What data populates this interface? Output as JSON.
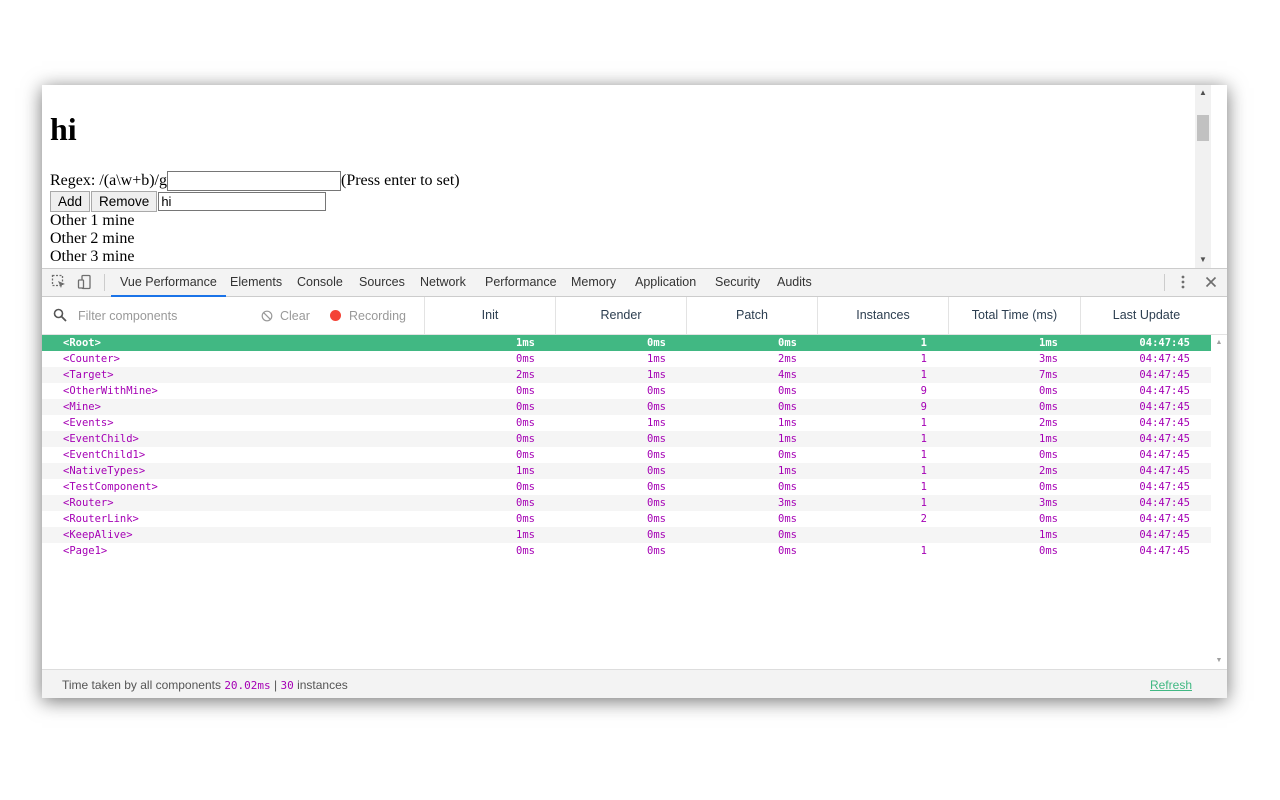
{
  "page": {
    "heading": "hi",
    "regex_label": "Regex: /(a\\w+b)/g",
    "regex_input_value": "",
    "regex_hint": "(Press enter to set)",
    "add_button": "Add",
    "remove_button": "Remove",
    "item_input_value": "hi",
    "others": [
      "Other 1 mine",
      "Other 2 mine",
      "Other 3 mine"
    ]
  },
  "devtools": {
    "tabs": [
      "Vue Performance",
      "Elements",
      "Console",
      "Sources",
      "Network",
      "Performance",
      "Memory",
      "Application",
      "Security",
      "Audits"
    ],
    "active_tab": "Vue Performance",
    "icons": [
      "inspect-element-icon",
      "device-toolbar-icon",
      "more-options-icon",
      "close-icon"
    ]
  },
  "toolbar": {
    "filter_placeholder": "Filter components",
    "clear_label": "Clear",
    "recording_label": "Recording",
    "recording_color": "#f44336"
  },
  "columns": [
    "Init",
    "Render",
    "Patch",
    "Instances",
    "Total Time (ms)",
    "Last Update"
  ],
  "rows": [
    {
      "name": "<Root>",
      "init": "1ms",
      "render": "0ms",
      "patch": "0ms",
      "instances": "1",
      "total": "1ms",
      "last": "04:47:45",
      "selected": true
    },
    {
      "name": "<Counter>",
      "init": "0ms",
      "render": "1ms",
      "patch": "2ms",
      "instances": "1",
      "total": "3ms",
      "last": "04:47:45"
    },
    {
      "name": "<Target>",
      "init": "2ms",
      "render": "1ms",
      "patch": "4ms",
      "instances": "1",
      "total": "7ms",
      "last": "04:47:45"
    },
    {
      "name": "<OtherWithMine>",
      "init": "0ms",
      "render": "0ms",
      "patch": "0ms",
      "instances": "9",
      "total": "0ms",
      "last": "04:47:45"
    },
    {
      "name": "<Mine>",
      "init": "0ms",
      "render": "0ms",
      "patch": "0ms",
      "instances": "9",
      "total": "0ms",
      "last": "04:47:45"
    },
    {
      "name": "<Events>",
      "init": "0ms",
      "render": "1ms",
      "patch": "1ms",
      "instances": "1",
      "total": "2ms",
      "last": "04:47:45"
    },
    {
      "name": "<EventChild>",
      "init": "0ms",
      "render": "0ms",
      "patch": "1ms",
      "instances": "1",
      "total": "1ms",
      "last": "04:47:45"
    },
    {
      "name": "<EventChild1>",
      "init": "0ms",
      "render": "0ms",
      "patch": "0ms",
      "instances": "1",
      "total": "0ms",
      "last": "04:47:45"
    },
    {
      "name": "<NativeTypes>",
      "init": "1ms",
      "render": "0ms",
      "patch": "1ms",
      "instances": "1",
      "total": "2ms",
      "last": "04:47:45"
    },
    {
      "name": "<TestComponent>",
      "init": "0ms",
      "render": "0ms",
      "patch": "0ms",
      "instances": "1",
      "total": "0ms",
      "last": "04:47:45"
    },
    {
      "name": "<Router>",
      "init": "0ms",
      "render": "0ms",
      "patch": "3ms",
      "instances": "1",
      "total": "3ms",
      "last": "04:47:45"
    },
    {
      "name": "<RouterLink>",
      "init": "0ms",
      "render": "0ms",
      "patch": "0ms",
      "instances": "2",
      "total": "0ms",
      "last": "04:47:45"
    },
    {
      "name": "<KeepAlive>",
      "init": "1ms",
      "render": "0ms",
      "patch": "0ms",
      "instances": "",
      "total": "1ms",
      "last": "04:47:45"
    },
    {
      "name": "<Page1>",
      "init": "0ms",
      "render": "0ms",
      "patch": "0ms",
      "instances": "1",
      "total": "0ms",
      "last": "04:47:45"
    }
  ],
  "footer": {
    "prefix": "Time taken by all components",
    "total_time": "20.02ms",
    "separator": "|",
    "instances": "30",
    "suffix": "instances",
    "refresh": "Refresh"
  },
  "colors": {
    "accent": "#41b883",
    "mono_text": "#a500b5",
    "active_tab_underline": "#1a73e8"
  }
}
